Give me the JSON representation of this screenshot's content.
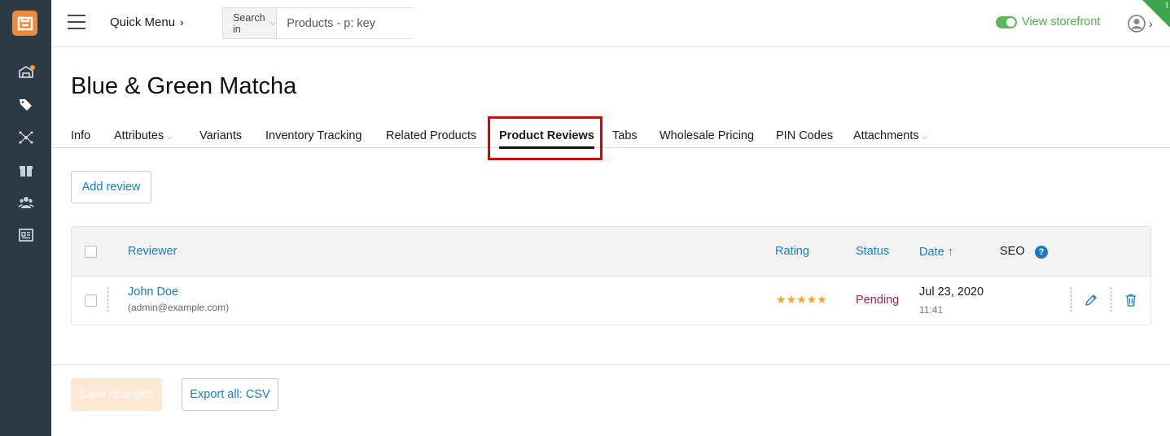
{
  "header": {
    "quick_menu": "Quick Menu",
    "search_in": "Search in",
    "search_placeholder": "Products - p: key",
    "view_storefront": "View storefront"
  },
  "page": {
    "title": "Blue & Green Matcha"
  },
  "tabs": [
    {
      "label": "Info"
    },
    {
      "label": "Attributes"
    },
    {
      "label": "Variants"
    },
    {
      "label": "Inventory Tracking"
    },
    {
      "label": "Related Products"
    },
    {
      "label": "Product Reviews",
      "active": true
    },
    {
      "label": "Tabs"
    },
    {
      "label": "Wholesale Pricing"
    },
    {
      "label": "PIN Codes"
    },
    {
      "label": "Attachments"
    }
  ],
  "add_review": "Add review",
  "table": {
    "columns": {
      "reviewer": "Reviewer",
      "rating": "Rating",
      "status": "Status",
      "date": "Date",
      "seo": "SEO"
    },
    "rows": [
      {
        "name": "John Doe",
        "email": "(admin@example.com)",
        "rating": 5,
        "rating_stars": "★★★★★",
        "status": "Pending",
        "date": "Jul 23, 2020",
        "time": "11:41"
      }
    ]
  },
  "footer": {
    "save": "Save changes",
    "export": "Export all: CSV"
  },
  "colors": {
    "link": "#1a7bbf",
    "sidebar": "#2b3a45",
    "brand": "#f08a3a",
    "pending": "#a12650",
    "star": "#f5a623",
    "storefront": "#4caf50",
    "highlight": "#e00000"
  }
}
